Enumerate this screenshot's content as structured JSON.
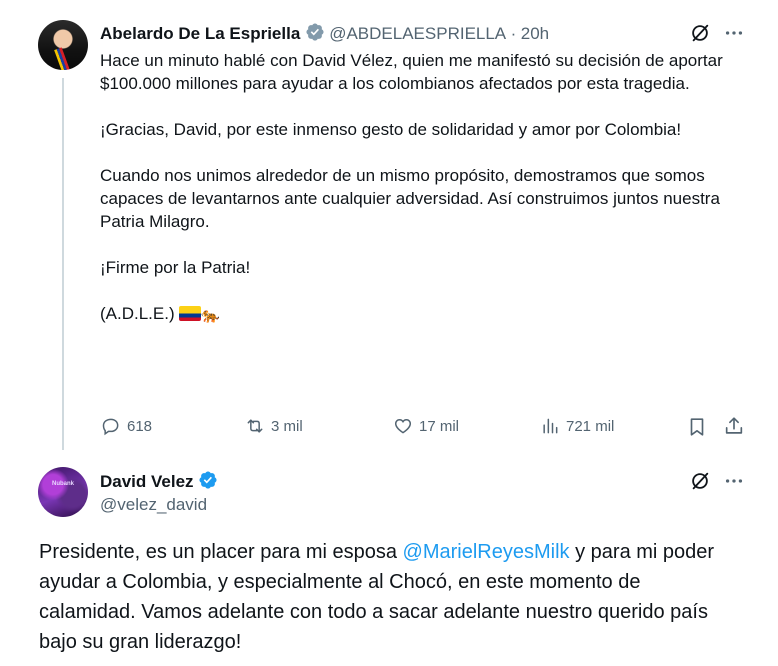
{
  "tweet1": {
    "author_name": "Abelardo De La Espriella",
    "handle": "@ABDELAESPRIELLA",
    "separator": "·",
    "time": "20h",
    "paragraphs": [
      "Hace un minuto hablé con David Vélez, quien me manifestó su decisión de aportar $100.000 millones para ayudar a los colombianos afectados por esta tragedia.",
      "¡Gracias, David, por este inmenso gesto de solidaridad y amor por Colombia!",
      "Cuando nos unimos alrededor de un mismo propósito, demostramos que somos capaces de levantarnos ante cualquier adversidad. Así construimos juntos nuestra Patria Milagro.",
      "¡Firme por la Patria!"
    ],
    "signature": "(A.D.L.E.)",
    "emoji": [
      "colombia-flag-emoji",
      "tiger-emoji"
    ],
    "actions": {
      "replies": "618",
      "reposts": "3 mil",
      "likes": "17 mil",
      "views": "721 mil"
    }
  },
  "tweet2": {
    "author_name": "David Velez",
    "handle": "@velez_david",
    "avatar_text": "Nubank",
    "text_before": "Presidente, es un placer para mi esposa ",
    "mention": "@MarielReyesMilk",
    "text_after": " y para mi poder ayudar a Colombia, y especialmente al Chocó, en este momento de calamidad. Vamos adelante con todo a sacar adelante nuestro querido país bajo su gran liderazgo!"
  },
  "colors": {
    "verified": "#1d9bf0",
    "secondary_text": "#536471",
    "link": "#1d9bf0"
  }
}
